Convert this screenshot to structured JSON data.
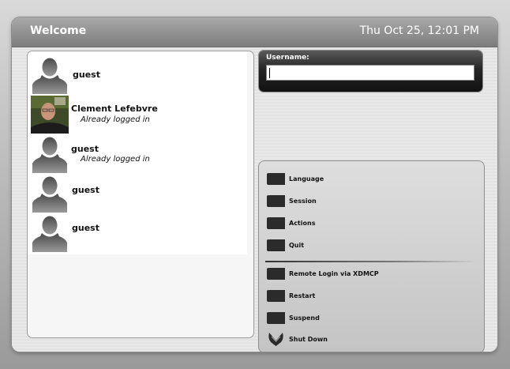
{
  "window": {
    "title": "Welcome",
    "clock": "Thu Oct 25, 12:01 PM"
  },
  "users": [
    {
      "name": "guest",
      "status": "",
      "avatar": "silhouette-icon"
    },
    {
      "name": "Clement Lefebvre",
      "status": "Already logged in",
      "avatar": "photo"
    },
    {
      "name": "guest",
      "status": "Already logged in",
      "avatar": "silhouette-icon"
    },
    {
      "name": "guest",
      "status": "",
      "avatar": "silhouette-icon"
    },
    {
      "name": "guest",
      "status": "",
      "avatar": "silhouette-icon"
    }
  ],
  "login": {
    "label": "Username:",
    "value": ""
  },
  "menu": {
    "language": "Language",
    "session": "Session",
    "actions": "Actions",
    "quit": "Quit",
    "xdmcp": "Remote Login via XDMCP",
    "restart": "Restart",
    "suspend": "Suspend",
    "shutdown": "Shut Down"
  }
}
